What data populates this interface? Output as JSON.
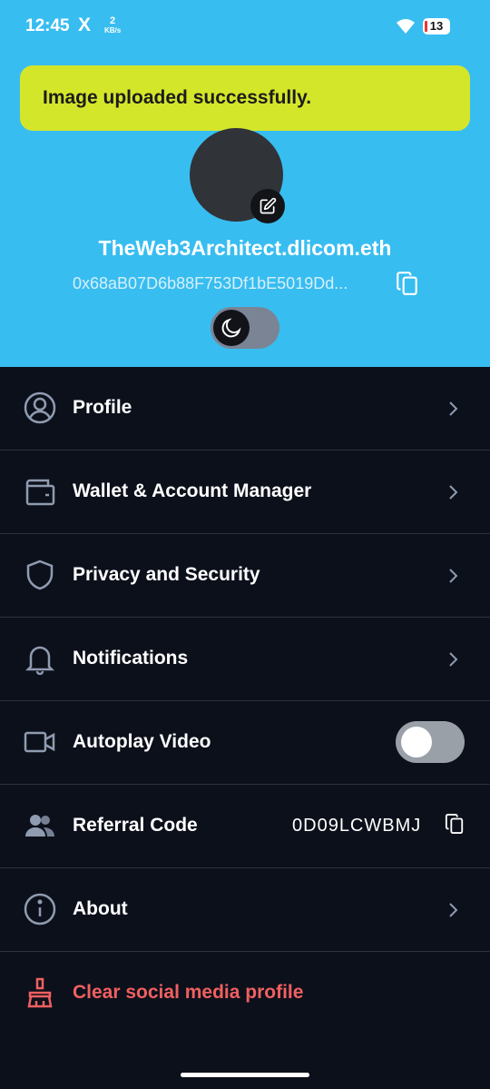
{
  "status_bar": {
    "time": "12:45",
    "x_logo": "X",
    "speed_value": "2",
    "speed_unit": "KB/s",
    "battery": "13"
  },
  "toast": {
    "message": "Image uploaded successfully."
  },
  "profile": {
    "username": "TheWeb3Architect.dlicom.eth",
    "address": "0x68aB07D6b88F753Df1bE5019Dd..."
  },
  "menu": {
    "profile": "Profile",
    "wallet": "Wallet & Account Manager",
    "privacy": "Privacy and Security",
    "notifications": "Notifications",
    "autoplay": "Autoplay Video",
    "referral": "Referral Code",
    "referral_code": "0D09LCWBMJ",
    "about": "About",
    "clear": "Clear social media profile"
  },
  "colors": {
    "header": "#38bdf0",
    "toast": "#d4e62a",
    "background": "#0c101b",
    "danger": "#f06060"
  },
  "state": {
    "dark_mode": true,
    "autoplay_video": false
  }
}
